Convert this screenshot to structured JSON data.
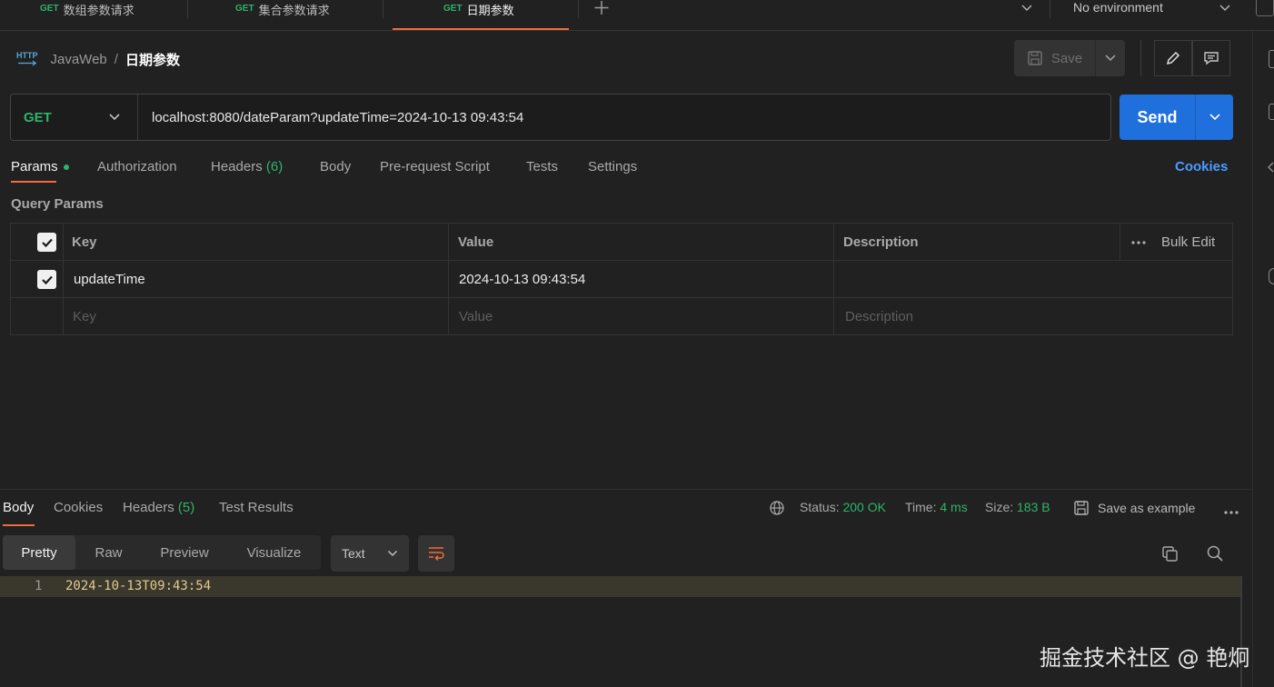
{
  "tabs": [
    {
      "method": "GET",
      "label": "数组参数请求"
    },
    {
      "method": "GET",
      "label": "集合参数请求"
    },
    {
      "method": "GET",
      "label": "日期参数",
      "active": true
    }
  ],
  "environment": "No environment",
  "breadcrumb": {
    "protocol_icon": "HTTP",
    "parent": "JavaWeb",
    "separator": "/",
    "current": "日期参数"
  },
  "toolbar": {
    "save_label": "Save"
  },
  "request": {
    "method": "GET",
    "url": "localhost:8080/dateParam?updateTime=2024-10-13 09:43:54",
    "send_label": "Send"
  },
  "request_tabs": {
    "params": "Params",
    "authorization": "Authorization",
    "headers": "Headers",
    "headers_count": "(6)",
    "body": "Body",
    "prerequest": "Pre-request Script",
    "tests": "Tests",
    "settings": "Settings",
    "cookies": "Cookies"
  },
  "query_params": {
    "title": "Query Params",
    "headers": {
      "key": "Key",
      "value": "Value",
      "description": "Description",
      "bulk_edit": "Bulk Edit"
    },
    "rows": [
      {
        "key": "updateTime",
        "value": "2024-10-13 09:43:54",
        "description": "",
        "checked": true
      }
    ],
    "placeholders": {
      "key": "Key",
      "value": "Value",
      "description": "Description"
    }
  },
  "response": {
    "tabs": {
      "body": "Body",
      "cookies": "Cookies",
      "headers": "Headers",
      "headers_count": "(5)",
      "test_results": "Test Results"
    },
    "status_label": "Status:",
    "status_value": "200 OK",
    "time_label": "Time:",
    "time_value": "4 ms",
    "size_label": "Size:",
    "size_value": "183 B",
    "save_example": "Save as example",
    "view_tabs": {
      "pretty": "Pretty",
      "raw": "Raw",
      "preview": "Preview",
      "visualize": "Visualize"
    },
    "format": "Text",
    "line_number": "1",
    "body_text": "2024-10-13T09:43:54"
  },
  "watermark": "掘金技术社区 @ 艳炯",
  "colors": {
    "accent_orange": "#f26b3a",
    "method_green": "#2fb36a",
    "send_blue": "#1f6fdc",
    "link_blue": "#4a9cff"
  }
}
